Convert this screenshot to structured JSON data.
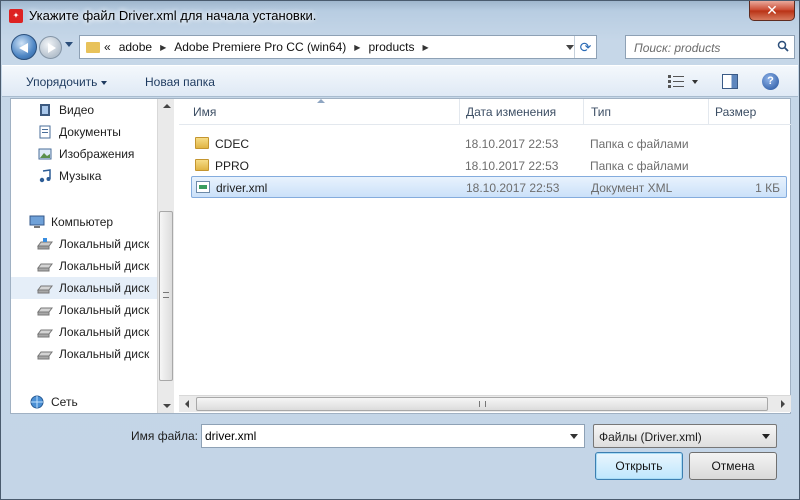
{
  "window": {
    "title": "Укажите файл Driver.xml для начала установки.",
    "close_label": "✕"
  },
  "address": {
    "prefix": "«",
    "crumbs": [
      "adobe",
      "Adobe Premiere Pro CC (win64)",
      "products"
    ],
    "search_placeholder": "Поиск: products"
  },
  "toolbar": {
    "organize": "Упорядочить",
    "new_folder": "Новая папка",
    "help": "?"
  },
  "nav": {
    "items": [
      {
        "label": "Видео",
        "icon": "video-library-icon"
      },
      {
        "label": "Документы",
        "icon": "documents-library-icon"
      },
      {
        "label": "Изображения",
        "icon": "pictures-library-icon"
      },
      {
        "label": "Музыка",
        "icon": "music-library-icon"
      },
      {
        "label": "Компьютер",
        "icon": "computer-icon"
      },
      {
        "label": "Локальный диск",
        "icon": "system-drive-icon"
      },
      {
        "label": "Локальный диск",
        "icon": "drive-icon"
      },
      {
        "label": "Локальный диск",
        "icon": "drive-icon",
        "selected": true
      },
      {
        "label": "Локальный диск",
        "icon": "drive-icon"
      },
      {
        "label": "Локальный диск",
        "icon": "drive-icon"
      },
      {
        "label": "Локальный диск",
        "icon": "drive-icon"
      },
      {
        "label": "Сеть",
        "icon": "network-icon"
      }
    ]
  },
  "files": {
    "columns": [
      "Имя",
      "Дата изменения",
      "Тип",
      "Размер"
    ],
    "rows": [
      {
        "name": "CDEC",
        "date": "18.10.2017 22:53",
        "type": "Папка с файлами",
        "size": "",
        "icon": "folder-icon"
      },
      {
        "name": "PPRO",
        "date": "18.10.2017 22:53",
        "type": "Папка с файлами",
        "size": "",
        "icon": "folder-icon"
      },
      {
        "name": "driver.xml",
        "date": "18.10.2017 22:53",
        "type": "Документ XML",
        "size": "1 КБ",
        "icon": "xml-file-icon",
        "selected": true
      }
    ]
  },
  "bottom": {
    "filename_label": "Имя файла:",
    "filename_value": "driver.xml",
    "filetype": "Файлы (Driver.xml)",
    "open_label": "Открыть",
    "cancel_label": "Отмена"
  },
  "colors": {
    "selection": "#cbe1f9",
    "accent": "#3c7fb1",
    "close": "#c9462c"
  }
}
